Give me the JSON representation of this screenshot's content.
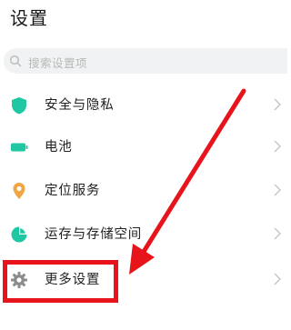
{
  "header": {
    "title": "设置"
  },
  "search": {
    "placeholder": "搜索设置项"
  },
  "settings": {
    "items": [
      {
        "label": "安全与隐私",
        "icon": "shield-icon",
        "color": "#1fc7a3"
      },
      {
        "label": "电池",
        "icon": "battery-icon",
        "color": "#1fc7a3"
      },
      {
        "label": "定位服务",
        "icon": "location-pin-icon",
        "color": "#f2a540"
      },
      {
        "label": "运存与存储空间",
        "icon": "storage-pie-icon",
        "color": "#1fc7a3"
      },
      {
        "label": "更多设置",
        "icon": "gear-icon",
        "color": "#8c8c8c"
      }
    ]
  },
  "annotation": {
    "highlight_color": "#e8141b",
    "target": "更多设置"
  }
}
